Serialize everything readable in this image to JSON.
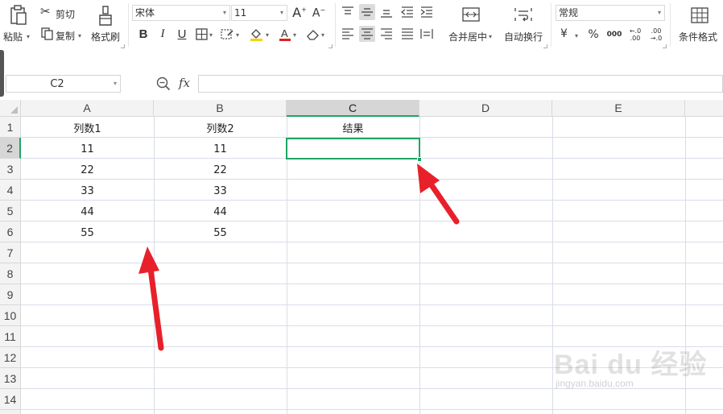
{
  "ribbon": {
    "paste_label": "粘贴",
    "cut_label": "剪切",
    "copy_label": "复制",
    "format_painter_label": "格式刷",
    "font_name": "宋体",
    "font_size": "11",
    "merge_center_label": "合并居中",
    "wrap_text_label": "自动换行",
    "number_format": "常规",
    "currency_symbol": "¥",
    "percent_symbol": "%",
    "thousands_symbol": "000",
    "increase_decimal_symbol": "←.0 .00",
    "decrease_decimal_symbol": ".00 →.0",
    "conditional_format_label": "条件格式"
  },
  "formula_bar": {
    "name_box": "C2",
    "fx_label": "fx",
    "formula": ""
  },
  "sheet": {
    "columns": [
      "A",
      "B",
      "C",
      "D",
      "E"
    ],
    "rows": [
      "1",
      "2",
      "3",
      "4",
      "5",
      "6",
      "7",
      "8",
      "9",
      "10",
      "11",
      "12",
      "13",
      "14"
    ],
    "cells": {
      "A1": "列数1",
      "B1": "列数2",
      "C1": "结果",
      "A2": "11",
      "B2": "11",
      "A3": "22",
      "B3": "22",
      "A4": "33",
      "B4": "33",
      "A5": "44",
      "B5": "44",
      "A6": "55",
      "B6": "55"
    },
    "selected_cell": "C2",
    "selection_color": "#21a366"
  },
  "watermark": {
    "brand": "Bai du 经验",
    "url": "jingyan.baidu.com"
  },
  "annotations": {
    "arrow_color": "#e8202a"
  }
}
